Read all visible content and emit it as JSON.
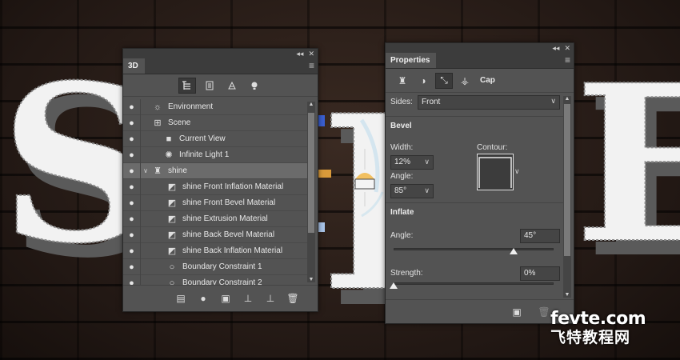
{
  "panel3d": {
    "title": "3D",
    "collapse_icon": "double-chevron-left",
    "close_icon": "close-x",
    "menu_icon": "hamburger",
    "toolbar": [
      {
        "name": "filter-whole-scene-icon",
        "active": true
      },
      {
        "name": "filter-meshes-icon",
        "active": false
      },
      {
        "name": "filter-materials-icon",
        "active": false
      },
      {
        "name": "filter-lights-icon",
        "active": false
      }
    ],
    "rows": [
      {
        "label": "Environment",
        "icon": "environment-icon",
        "indent": 0,
        "expander": false
      },
      {
        "label": "Scene",
        "icon": "scene-icon",
        "indent": 0,
        "expander": false
      },
      {
        "label": "Current View",
        "icon": "camera-icon",
        "indent": 1,
        "expander": false
      },
      {
        "label": "Infinite Light 1",
        "icon": "light-icon",
        "indent": 1,
        "expander": false
      },
      {
        "label": "shine",
        "icon": "mesh-icon",
        "indent": 0,
        "expander": true,
        "selected": true
      },
      {
        "label": "shine Front Inflation Material",
        "icon": "material-icon",
        "indent": 2
      },
      {
        "label": "shine Front Bevel Material",
        "icon": "material-icon",
        "indent": 2
      },
      {
        "label": "shine Extrusion Material",
        "icon": "material-icon",
        "indent": 2
      },
      {
        "label": "shine Back Bevel Material",
        "icon": "material-icon",
        "indent": 2
      },
      {
        "label": "shine Back Inflation Material",
        "icon": "material-icon",
        "indent": 2
      },
      {
        "label": "Boundary Constraint 1",
        "icon": "constraint-icon",
        "indent": 2
      },
      {
        "label": "Boundary Constraint 2",
        "icon": "constraint-icon",
        "indent": 2
      }
    ],
    "footer": [
      "new-mesh-icon",
      "add-light-icon",
      "render-icon",
      "drop-to-plane-icon",
      "drop-add-icon",
      "trash-icon"
    ]
  },
  "properties": {
    "title": "Properties",
    "tab_label": "Cap",
    "sides_label": "Sides:",
    "sides_value": "Front",
    "bevel_head": "Bevel",
    "width_label": "Width:",
    "width_value": "12%",
    "contour_label": "Contour:",
    "angle_label": "Angle:",
    "angle_value": "85°",
    "inflate_head": "Inflate",
    "inflate_angle_label": "Angle:",
    "inflate_angle_value": "45°",
    "inflate_angle_fraction": 0.75,
    "strength_label": "Strength:",
    "strength_value": "0%",
    "strength_fraction": 0.0
  },
  "watermark": {
    "top": "fevte.com",
    "bottom": "飞特教程网"
  },
  "colors": {
    "panel": "#535353",
    "panel_dark": "#3c3c3c",
    "selected_row": "#6b6b6b"
  }
}
